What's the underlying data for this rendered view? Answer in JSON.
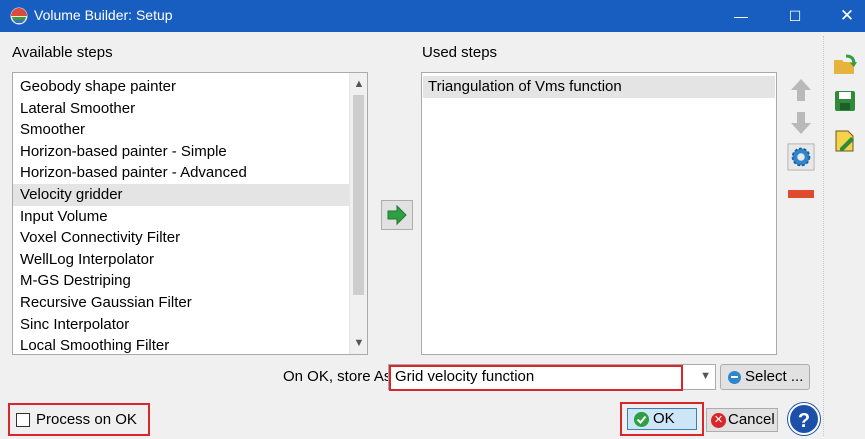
{
  "window": {
    "title": "Volume Builder: Setup",
    "minimize_glyph": "—",
    "maximize_glyph": "☐",
    "close_glyph": "✕"
  },
  "available": {
    "label": "Available steps",
    "items": [
      "Geobody shape painter",
      "Lateral Smoother",
      "Smoother",
      "Horizon-based painter - Simple",
      "Horizon-based painter - Advanced",
      "Velocity gridder",
      "Input Volume",
      "Voxel Connectivity Filter",
      "WellLog Interpolator",
      "M-GS Destriping",
      "Recursive Gaussian Filter",
      "Sinc Interpolator",
      "Local Smoothing Filter"
    ],
    "selected": "Velocity gridder"
  },
  "used": {
    "label": "Used steps",
    "items": [
      "Triangulation of Vms function"
    ]
  },
  "store": {
    "label": "On OK, store As",
    "value": "Grid velocity function",
    "select_label": "Select ..."
  },
  "process": {
    "label": "Process on OK",
    "checked": false
  },
  "buttons": {
    "ok": "OK",
    "cancel": "Cancel",
    "help": "?"
  },
  "icons": {
    "app": "volume-builder-icon",
    "transfer": "green-arrow-right-icon",
    "up": "arrow-up-icon",
    "down": "arrow-down-icon",
    "settings": "gear-icon",
    "remove": "minus-icon",
    "open": "open-folder-icon",
    "save": "save-disk-icon",
    "edit": "edit-document-icon"
  },
  "colors": {
    "titlebar": "#185ec0",
    "highlight_border": "#d9262c",
    "selection": "#e4e4e4",
    "ok_button": "#cde6f7",
    "green_arrow": "#2ea043"
  }
}
